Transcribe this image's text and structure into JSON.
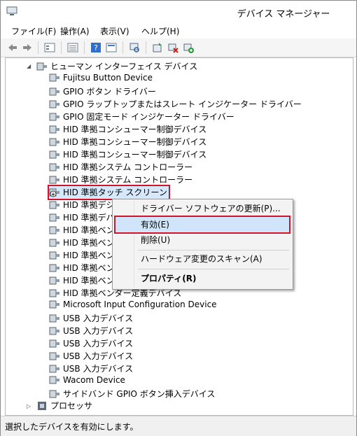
{
  "window": {
    "title": "デバイス マネージャー"
  },
  "menu": [
    "ファイル(F)",
    "操作(A)",
    "表示(V)",
    "ヘルプ(H)"
  ],
  "tree": {
    "category": "ヒューマン インターフェイス デバイス",
    "items": [
      "Fujitsu Button Device",
      "GPIO ボタン ドライバー",
      "GPIO ラップトップまたはスレート インジケーター ドライバー",
      "GPIO 固定モード インジケーター ドライバー",
      "HID 準拠コンシューマー制御デバイス",
      "HID 準拠コンシューマー制御デバイス",
      "HID 準拠コンシューマー制御デバイス",
      "HID 準拠システム コントローラー",
      "HID 準拠システム コントローラー",
      "HID 準拠タッチ スクリーン",
      "HID 準拠デジ",
      "HID 準拠デバ",
      "HID 準拠ベン",
      "HID 準拠ベン",
      "HID 準拠ベン",
      "HID 準拠ベン",
      "HID 準拠ベン",
      "HID 準拠ベンダー定義デバイス",
      "Microsoft Input Configuration Device",
      "USB 入力デバイス",
      "USB 入力デバイス",
      "USB 入力デバイス",
      "USB 入力デバイス",
      "USB 入力デバイス",
      "Wacom Device",
      "サイドバンド GPIO ボタン挿入デバイス"
    ],
    "next_category": "プロセッサ"
  },
  "context_menu": {
    "update": "ドライバー ソフトウェアの更新(P)...",
    "enable": "有効(E)",
    "delete": "削除(U)",
    "scan": "ハードウェア変更のスキャン(A)",
    "properties": "プロパティ(R)"
  },
  "status": "選択したデバイスを有効にします。"
}
